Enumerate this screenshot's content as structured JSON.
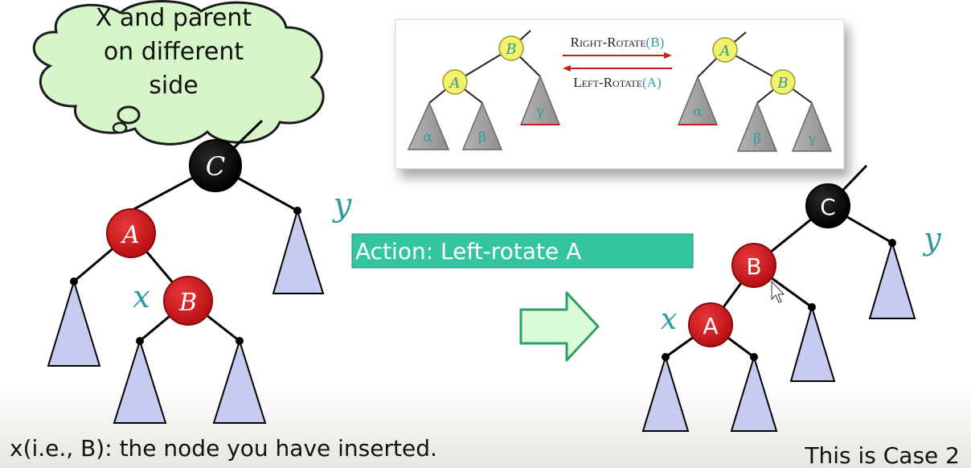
{
  "cloud": {
    "lines": [
      "X and parent",
      "on different",
      "side"
    ]
  },
  "inset": {
    "left_tree": {
      "top": "B",
      "child": "A",
      "leaves": [
        "α",
        "β",
        "γ"
      ]
    },
    "right_tree": {
      "top": "A",
      "child": "B",
      "leaves": [
        "α",
        "β",
        "γ"
      ]
    },
    "right_rotate": {
      "small_caps": "Right-Rotate",
      "arg": "(B)"
    },
    "left_rotate": {
      "small_caps": "Left-Rotate",
      "arg": "(A)"
    }
  },
  "left_tree": {
    "root": "C",
    "left_child": "A",
    "inserted": "B",
    "x_label": "x",
    "y_label": "y"
  },
  "action": {
    "label": "Action: Left-rotate A"
  },
  "right_tree": {
    "root": "C",
    "left_child": "B",
    "inserted": "A",
    "x_label": "x",
    "y_label": "y"
  },
  "captions": {
    "bottom_left": "x(i.e., B): the node you have inserted.",
    "bottom_right": "This is Case 2"
  },
  "colors": {
    "red_node": "#cc1418",
    "black_node": "#000000",
    "subtree_fill": "#c8cbf0",
    "yellow_node": "#f3f06a",
    "gray_subtree": "#9d9d9d",
    "teal_text": "#2e9aa0",
    "cloud_fill": "#d6f5c8",
    "action_fill": "#35c4a0",
    "arrow_fill": "#d9fbd6",
    "arrow_stroke": "#2f9e66",
    "rotate_arrow": "#c0201e"
  }
}
